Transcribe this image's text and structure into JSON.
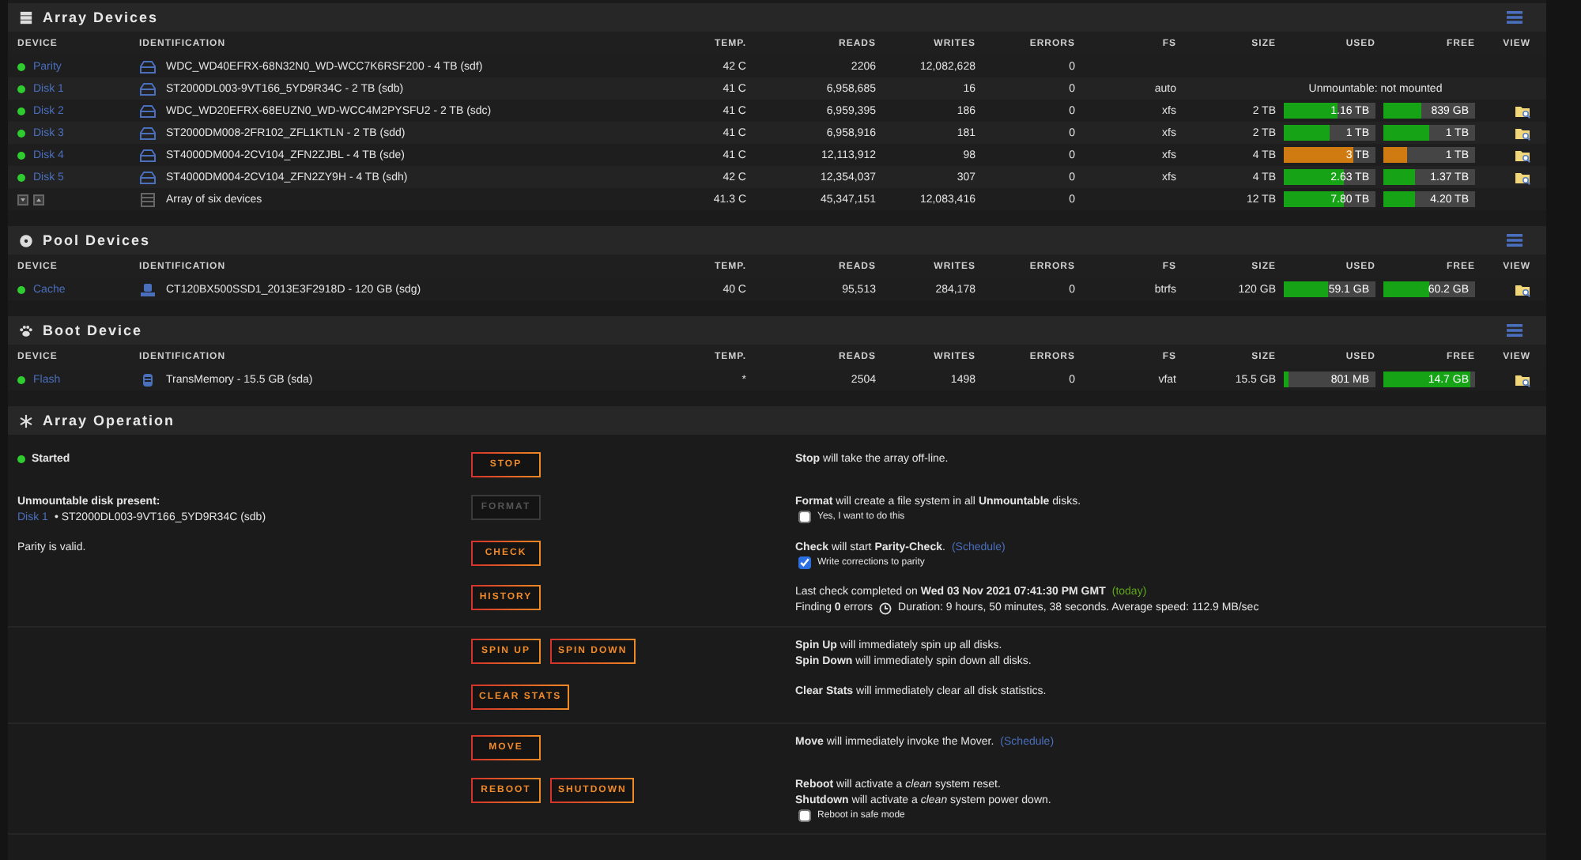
{
  "sections": [
    {
      "kind": "table",
      "title": "Array Devices",
      "columns": [
        "DEVICE",
        "IDENTIFICATION",
        "TEMP.",
        "READS",
        "WRITES",
        "ERRORS",
        "FS",
        "SIZE",
        "USED",
        "FREE",
        "VIEW"
      ],
      "rows": [
        {
          "kind": "hdd",
          "device": "Parity",
          "color": "#2fcc2f",
          "identification": "WDC_WD40EFRX-68N32N0_WD-WCC7K6RSF200 - 4 TB (sdf)",
          "temp": "42 C",
          "reads": "2206",
          "writes": "12,082,628",
          "errors": "0",
          "view": false
        },
        {
          "kind": "hdd",
          "device": "Disk 1",
          "color": "#2fcc2f",
          "identification": "ST2000DL003-9VT166_5YD9R34C - 2 TB (sdb)",
          "temp": "41 C",
          "reads": "6,958,685",
          "writes": "16",
          "errors": "0",
          "fs": "auto",
          "status": "Unmountable: not mounted",
          "view": false
        },
        {
          "kind": "hdd",
          "device": "Disk 2",
          "color": "#2fcc2f",
          "identification": "WDC_WD20EFRX-68EUZN0_WD-WCC4M2PYSFU2 - 2 TB (sdc)",
          "temp": "41 C",
          "reads": "6,959,395",
          "writes": "186",
          "errors": "0",
          "fs": "xfs",
          "size": "2 TB",
          "used": {
            "text": "1.16 TB",
            "level": 0.58,
            "color": "#16a316"
          },
          "free": {
            "text": "839 GB",
            "level": 0.42,
            "color": "#16a316"
          },
          "view": true
        },
        {
          "kind": "hdd",
          "device": "Disk 3",
          "color": "#2fcc2f",
          "identification": "ST2000DM008-2FR102_ZFL1KTLN - 2 TB (sdd)",
          "temp": "41 C",
          "reads": "6,958,916",
          "writes": "181",
          "errors": "0",
          "fs": "xfs",
          "size": "2 TB",
          "used": {
            "text": "1 TB",
            "level": 0.5,
            "color": "#16a316"
          },
          "free": {
            "text": "1 TB",
            "level": 0.5,
            "color": "#16a316"
          },
          "view": true
        },
        {
          "kind": "hdd",
          "device": "Disk 4",
          "color": "#2fcc2f",
          "identification": "ST4000DM004-2CV104_ZFN2ZJBL - 4 TB (sde)",
          "temp": "41 C",
          "reads": "12,113,912",
          "writes": "98",
          "errors": "0",
          "fs": "xfs",
          "size": "4 TB",
          "used": {
            "text": "3 TB",
            "level": 0.75,
            "color": "#d07a12"
          },
          "free": {
            "text": "1 TB",
            "level": 0.25,
            "color": "#d07a12"
          },
          "view": true
        },
        {
          "kind": "hdd",
          "device": "Disk 5",
          "color": "#2fcc2f",
          "identification": "ST4000DM004-2CV104_ZFN2ZY9H - 4 TB (sdh)",
          "temp": "42 C",
          "reads": "12,354,037",
          "writes": "307",
          "errors": "0",
          "fs": "xfs",
          "size": "4 TB",
          "used": {
            "text": "2.63 TB",
            "level": 0.66,
            "color": "#16a316"
          },
          "free": {
            "text": "1.37 TB",
            "level": 0.34,
            "color": "#16a316"
          },
          "view": true
        },
        {
          "kind": "summary",
          "identification": "Array of six devices",
          "temp": "41.3 C",
          "reads": "45,347,151",
          "writes": "12,083,416",
          "errors": "0",
          "size": "12 TB",
          "used": {
            "text": "7.80 TB",
            "level": 0.65,
            "color": "#16a316"
          },
          "free": {
            "text": "4.20 TB",
            "level": 0.35,
            "color": "#16a316"
          },
          "view": false
        }
      ]
    },
    {
      "kind": "table",
      "title": "Pool Devices",
      "columns": [
        "DEVICE",
        "IDENTIFICATION",
        "TEMP.",
        "READS",
        "WRITES",
        "ERRORS",
        "FS",
        "SIZE",
        "USED",
        "FREE",
        "VIEW"
      ],
      "rows": [
        {
          "kind": "ssd",
          "device": "Cache",
          "color": "#2fcc2f",
          "identification": "CT120BX500SSD1_2013E3F2918D - 120 GB (sdg)",
          "temp": "40 C",
          "reads": "95,513",
          "writes": "284,178",
          "errors": "0",
          "fs": "btrfs",
          "size": "120 GB",
          "used": {
            "text": "59.1 GB",
            "level": 0.49,
            "color": "#16a316"
          },
          "free": {
            "text": "60.2 GB",
            "level": 0.5,
            "color": "#16a316"
          },
          "view": true
        }
      ]
    },
    {
      "kind": "table",
      "title": "Boot Device",
      "columns": [
        "DEVICE",
        "IDENTIFICATION",
        "TEMP.",
        "READS",
        "WRITES",
        "ERRORS",
        "FS",
        "SIZE",
        "USED",
        "FREE",
        "VIEW"
      ],
      "rows": [
        {
          "kind": "flash",
          "device": "Flash",
          "color": "#2fcc2f",
          "identification": "TransMemory - 15.5 GB (sda)",
          "temp": "*",
          "reads": "2504",
          "writes": "1498",
          "errors": "0",
          "fs": "vfat",
          "size": "15.5 GB",
          "used": {
            "text": "801 MB",
            "level": 0.05,
            "color": "#16a316"
          },
          "free": {
            "text": "14.7 GB",
            "level": 0.95,
            "color": "#16a316"
          },
          "view": true
        }
      ]
    },
    {
      "kind": "operation",
      "title": "Array Operation",
      "groups": [
        [
          {
            "left": [
              [
                {
                  "kind": "status",
                  "text": "Started",
                  "color": "#2fcc2f"
                }
              ]
            ],
            "buttons": [
              {
                "label": "STOP",
                "disabled": false
              }
            ],
            "lines": [
              [
                {
                  "kind": "text",
                  "text": "**Stop** will take the array off-line."
                }
              ]
            ]
          },
          {
            "left": [
              [
                {
                  "kind": "bold",
                  "text": "Unmountable disk present:"
                }
              ],
              [
                {
                  "kind": "link",
                  "text": "Disk 1"
                },
                {
                  "kind": "text",
                  "text": "• ST2000DL003-9VT166_5YD9R34C (sdb)"
                }
              ]
            ],
            "buttons": [
              {
                "label": "FORMAT",
                "disabled": true
              }
            ],
            "lines": [
              [
                {
                  "kind": "text",
                  "text": "**Format** will create a file system in all **Unmountable** disks."
                }
              ]
            ],
            "checkbox": {
              "label": "Yes, I want to do this",
              "checked": false
            }
          },
          {
            "left": [
              [
                {
                  "kind": "text",
                  "text": "Parity is valid."
                }
              ]
            ],
            "buttons": [
              {
                "label": "CHECK",
                "disabled": false
              }
            ],
            "lines": [
              [
                {
                  "kind": "text",
                  "text": "**Check** will start **Parity-Check**."
                },
                {
                  "kind": "link",
                  "text": "(Schedule)"
                }
              ]
            ],
            "checkbox": {
              "label": "Write corrections to parity",
              "checked": true
            }
          },
          {
            "buttons": [
              {
                "label": "HISTORY",
                "disabled": false
              }
            ],
            "lines": [
              [
                {
                  "kind": "text",
                  "text": "Last check completed on **Wed 03 Nov 2021 07:41:30 PM GMT**"
                },
                {
                  "kind": "note",
                  "text": "(today)"
                }
              ],
              [
                {
                  "kind": "text",
                  "text": "Finding **0** errors"
                },
                {
                  "kind": "clock",
                  "text": "Duration: 9 hours, 50 minutes, 38 seconds. Average speed: 112.9 MB/sec"
                }
              ]
            ]
          }
        ],
        [
          {
            "buttons": [
              {
                "label": "SPIN UP",
                "disabled": false
              },
              {
                "label": "SPIN DOWN",
                "disabled": false
              }
            ],
            "lines": [
              [
                {
                  "kind": "text",
                  "text": "**Spin Up** will immediately spin up all disks."
                }
              ],
              [
                {
                  "kind": "text",
                  "text": "**Spin Down** will immediately spin down all disks."
                }
              ]
            ]
          },
          {
            "buttons": [
              {
                "label": "CLEAR STATS",
                "disabled": false
              }
            ],
            "lines": [
              [
                {
                  "kind": "text",
                  "text": "**Clear Stats** will immediately clear all disk statistics."
                }
              ]
            ]
          }
        ],
        [
          {
            "buttons": [
              {
                "label": "MOVE",
                "disabled": false
              }
            ],
            "lines": [
              [
                {
                  "kind": "text",
                  "text": "**Move** will immediately invoke the Mover."
                },
                {
                  "kind": "link",
                  "text": "(Schedule)"
                }
              ]
            ]
          },
          {
            "buttons": [
              {
                "label": "REBOOT",
                "disabled": false
              },
              {
                "label": "SHUTDOWN",
                "disabled": false
              }
            ],
            "lines": [
              [
                {
                  "kind": "text",
                  "text": "**Reboot** will activate a *clean* system reset."
                }
              ],
              [
                {
                  "kind": "text",
                  "text": "**Shutdown** will activate a *clean* system power down."
                }
              ]
            ],
            "checkbox": {
              "label": "Reboot in safe mode",
              "checked": false
            }
          }
        ]
      ]
    }
  ]
}
